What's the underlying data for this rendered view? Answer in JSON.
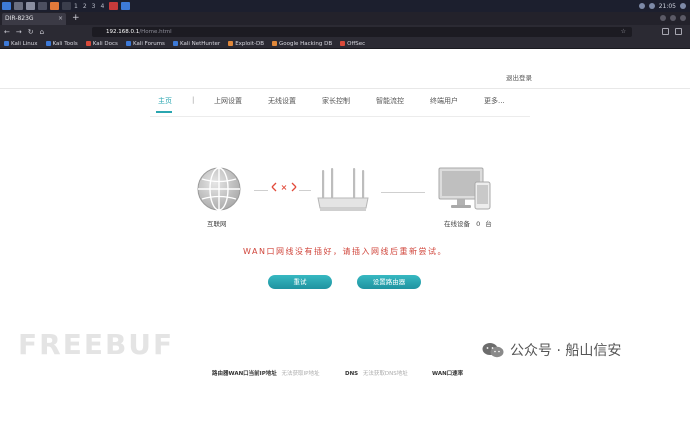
{
  "taskbar": {
    "workspaces": [
      "1",
      "2",
      "3",
      "4"
    ],
    "time": "21:05"
  },
  "browser": {
    "tab_title": "DIR-823G",
    "tab_close": "×",
    "new_tab": "+",
    "url_host": "192.168.0.1",
    "url_path": "/Home.html",
    "bookmarks": [
      "Kali Linux",
      "Kali Tools",
      "Kali Docs",
      "Kali Forums",
      "Kali NetHunter",
      "Exploit-DB",
      "Google Hacking DB",
      "OffSec"
    ]
  },
  "page": {
    "logout": "退出登录",
    "menu": {
      "home": "主页",
      "separator": "|",
      "items": [
        "上网设置",
        "无线设置",
        "家长控制",
        "智能流控",
        "终端用户",
        "更多..."
      ]
    },
    "devices": {
      "internet_label": "互联网",
      "error_mark": "GXD",
      "clients_label": "在线设备",
      "clients_count": "0",
      "clients_unit": "台"
    },
    "warning": "WAN口网线没有插好，请插入网线后重新尝试。",
    "buttons": {
      "retry": "重试",
      "setup": "设置路由器"
    },
    "footer": {
      "wan_ip_label": "路由器WAN口当前IP地址",
      "wan_ip_value": "无法获取IP地址",
      "dns_label": "DNS",
      "dns_value": "无法获取DNS地址",
      "wan_speed_label": "WAN口速率"
    }
  },
  "watermarks": {
    "freebuf": "FREEBUF",
    "wechat": "公众号 · 船山信安"
  },
  "colors": {
    "accent": "#2aa6b0",
    "warning": "#d0453b",
    "error_mark": "#e24b3b"
  }
}
